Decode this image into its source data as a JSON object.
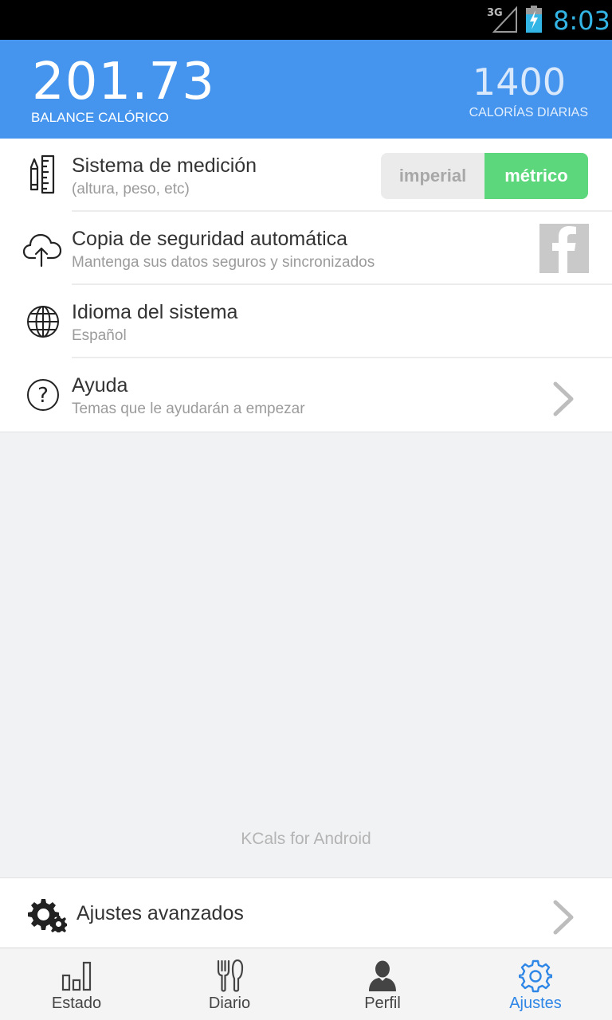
{
  "status_bar": {
    "network": "3G",
    "time": "8:03"
  },
  "header": {
    "balance_value": "201.73",
    "balance_label": "BALANCE CALÓRICO",
    "daily_value": "1400",
    "daily_label": "CALORÍAS DIARIAS"
  },
  "settings": {
    "measurement": {
      "title": "Sistema de medición",
      "subtitle": "(altura, peso, etc)",
      "options": [
        "imperial",
        "métrico"
      ],
      "selected": "métrico"
    },
    "backup": {
      "title": "Copia de seguridad automática",
      "subtitle": "Mantenga sus datos seguros y sincronizados",
      "facebook_icon": "facebook-icon"
    },
    "language": {
      "title": "Idioma del sistema",
      "subtitle": "Español"
    },
    "help": {
      "title": "Ayuda",
      "subtitle": "Temas que le ayudarán a empezar"
    }
  },
  "footer_text": "KCals for Android",
  "advanced": {
    "title": "Ajustes avanzados"
  },
  "tabs": [
    {
      "label": "Estado",
      "icon": "bar-chart-icon"
    },
    {
      "label": "Diario",
      "icon": "fork-knife-icon"
    },
    {
      "label": "Perfil",
      "icon": "person-icon"
    },
    {
      "label": "Ajustes",
      "icon": "gear-icon"
    }
  ],
  "active_tab": "Ajustes",
  "colors": {
    "header": "#4595ee",
    "toggle_on": "#5cd77b",
    "active_tab": "#2e86e6",
    "status_time": "#33b5e5"
  }
}
